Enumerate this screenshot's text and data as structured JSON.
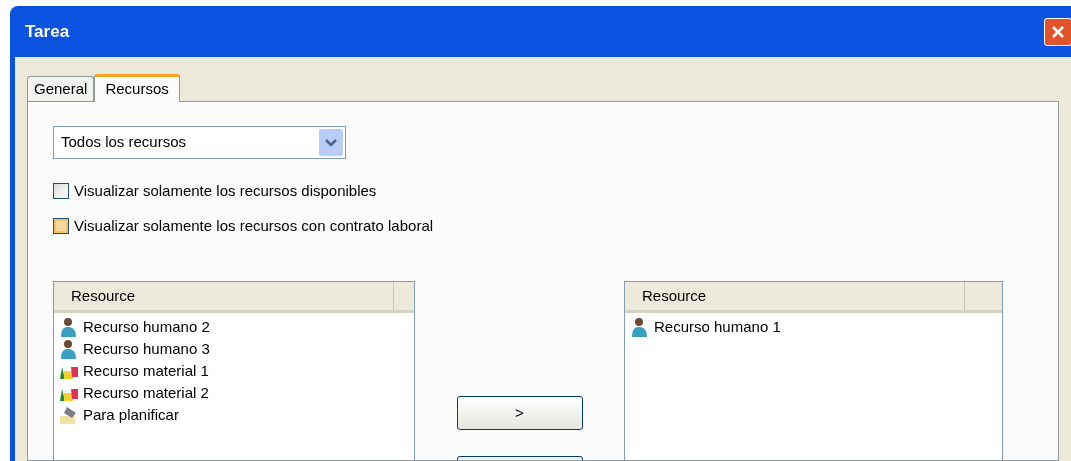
{
  "window": {
    "title": "Tarea"
  },
  "tabs": [
    {
      "label": "General",
      "selected": false
    },
    {
      "label": "Recursos",
      "selected": true
    }
  ],
  "filter": {
    "value": "Todos los recursos"
  },
  "options": [
    {
      "label": "Visualizar solamente los recursos disponibles",
      "checked": false,
      "highlighted": false
    },
    {
      "label": "Visualizar solamente los recursos con contrato laboral",
      "checked": false,
      "highlighted": true
    }
  ],
  "available": {
    "column": "Resource",
    "items": [
      {
        "kind": "human",
        "label": "Recurso humano 2"
      },
      {
        "kind": "human",
        "label": "Recurso humano 3"
      },
      {
        "kind": "material",
        "label": "Recurso material 1"
      },
      {
        "kind": "material",
        "label": "Recurso material 2"
      },
      {
        "kind": "planning",
        "label": "Para planificar"
      }
    ]
  },
  "buttons": [
    ">"
  ],
  "assigned": {
    "column": "Resource",
    "items": [
      {
        "kind": "human",
        "label": "Recurso humano 1"
      }
    ]
  }
}
